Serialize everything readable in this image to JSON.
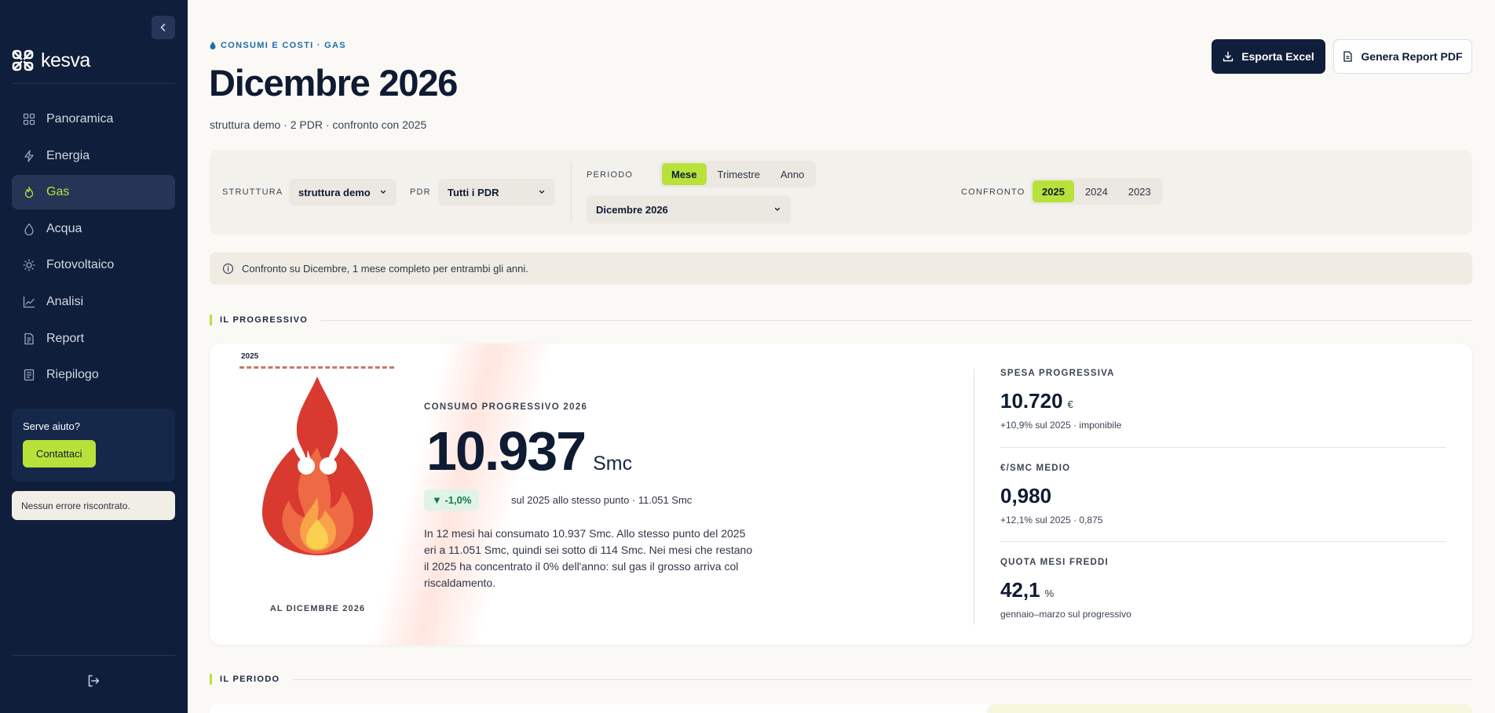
{
  "brand": {
    "name": "kesva",
    "accent": "#b8e23a",
    "navy": "#0f1e3a"
  },
  "sidebar": {
    "items": [
      {
        "label": "Panoramica",
        "icon": "grid-icon"
      },
      {
        "label": "Energia",
        "icon": "bolt-icon"
      },
      {
        "label": "Gas",
        "icon": "flame-icon",
        "active": true
      },
      {
        "label": "Acqua",
        "icon": "drop-icon"
      },
      {
        "label": "Fotovoltaico",
        "icon": "sun-icon"
      },
      {
        "label": "Analisi",
        "icon": "trend-icon"
      },
      {
        "label": "Report",
        "icon": "document-icon"
      },
      {
        "label": "Riepilogo",
        "icon": "list-icon"
      }
    ],
    "help": {
      "title": "Serve aiuto?",
      "button": "Contattaci"
    },
    "status": "Nessun errore riscontrato."
  },
  "header": {
    "eyebrow": "CONSUMI E COSTI · GAS",
    "title": "Dicembre 2026",
    "subtitle": "struttura demo · 2 PDR · confronto con 2025",
    "export_excel": "Esporta Excel",
    "export_pdf": "Genera Report PDF"
  },
  "filters": {
    "struttura_label": "STRUTTURA",
    "struttura_value": "struttura demo",
    "pdr_label": "PDR",
    "pdr_value": "Tutti i PDR",
    "periodo_label": "PERIODO",
    "periodo_options": [
      "Mese",
      "Trimestre",
      "Anno"
    ],
    "periodo_selected": "Mese",
    "periodo_value": "Dicembre 2026",
    "confronto_label": "CONFRONTO",
    "confronto_options": [
      "2025",
      "2024",
      "2023"
    ],
    "confronto_selected": "2025"
  },
  "info": "Confronto su Dicembre, 1 mese completo per entrambi gli anni.",
  "sections": {
    "progressivo": "IL PROGRESSIVO",
    "periodo": "IL PERIODO"
  },
  "progressivo": {
    "marker_year": "2025",
    "caption": "AL DICEMBRE 2026",
    "kpi_label": "CONSUMO PROGRESSIVO 2026",
    "kpi_value": "10.937",
    "kpi_unit": "Smc",
    "delta": "▼ -1,0%",
    "delta_note": "sul 2025 allo stesso punto · 11.051 Smc",
    "paragraph": "In 12 mesi hai consumato 10.937 Smc. Allo stesso punto del 2025 eri a 11.051 Smc, quindi sei sotto di 114 Smc. Nei mesi che restano il 2025 ha concentrato il 0% dell'anno: sul gas il grosso arriva col riscaldamento.",
    "stats": [
      {
        "label": "SPESA PROGRESSIVA",
        "value": "10.720",
        "unit": "€",
        "sub": "+10,9% sul 2025 · imponibile"
      },
      {
        "label": "€/SMC MEDIO",
        "value": "0,980",
        "unit": "",
        "sub": "+12,1% sul 2025 · 0,875"
      },
      {
        "label": "QUOTA MESI FREDDI",
        "value": "42,1",
        "unit": "%",
        "sub": "gennaio–marzo sul progressivo"
      }
    ]
  }
}
